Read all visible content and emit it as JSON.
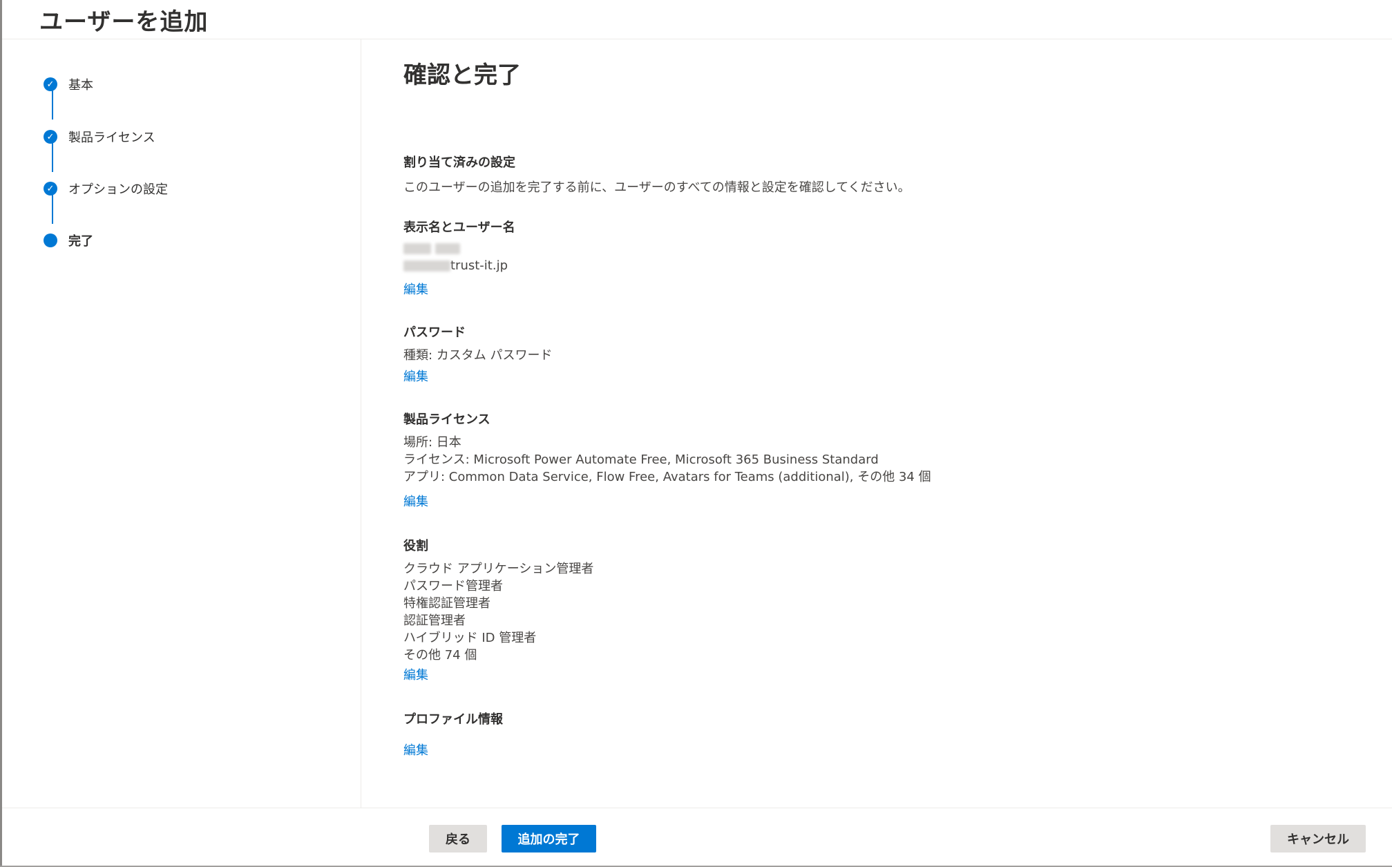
{
  "header": {
    "title": "ユーザーを追加"
  },
  "steps": [
    {
      "label": "基本",
      "state": "done",
      "icon": "check-icon"
    },
    {
      "label": "製品ライセンス",
      "state": "done",
      "icon": "check-icon"
    },
    {
      "label": "オプションの設定",
      "state": "done",
      "icon": "check-icon"
    },
    {
      "label": "完了",
      "state": "current",
      "icon": "dot-icon"
    }
  ],
  "main": {
    "title": "確認と完了",
    "assigned": {
      "title": "割り当て済みの設定",
      "description": "このユーザーの追加を完了する前に、ユーザーのすべての情報と設定を確認してください。"
    },
    "names": {
      "title": "表示名とユーザー名",
      "email_suffix": "trust-it.jp",
      "edit": "編集"
    },
    "password": {
      "title": "パスワード",
      "type": "種類: カスタム パスワード",
      "edit": "編集"
    },
    "license": {
      "title": "製品ライセンス",
      "location": "場所: 日本",
      "licenses": "ライセンス: Microsoft Power Automate Free, Microsoft 365 Business Standard",
      "apps": "アプリ: Common Data Service, Flow Free, Avatars for Teams (additional), その他 34 個",
      "edit": "編集"
    },
    "roles": {
      "title": "役割",
      "items": [
        "クラウド アプリケーション管理者",
        "パスワード管理者",
        "特権認証管理者",
        "認証管理者",
        "ハイブリッド ID 管理者",
        "その他 74 個"
      ],
      "edit": "編集"
    },
    "profile": {
      "title": "プロファイル情報",
      "edit": "編集"
    }
  },
  "footer": {
    "back": "戻る",
    "finish": "追加の完了",
    "cancel": "キャンセル"
  },
  "colors": {
    "accent": "#0078d4",
    "text": "#323130"
  }
}
